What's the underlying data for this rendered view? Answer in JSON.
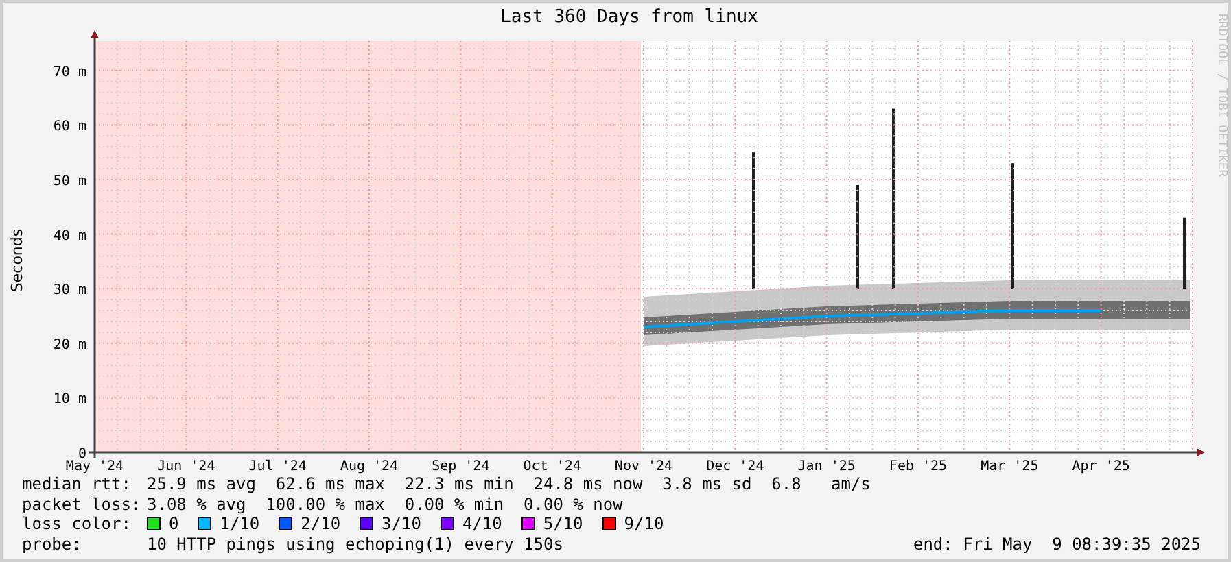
{
  "graph": {
    "credit": "RRDTOOL / TOBI OETIKER",
    "chart_data": {
      "type": "line",
      "title": "Last 360 Days from linux",
      "ylabel": "Seconds",
      "grid": true,
      "categories": [
        "May '24",
        "Jun '24",
        "Jul '24",
        "Aug '24",
        "Sep '24",
        "Oct '24",
        "Nov '24",
        "Dec '24",
        "Jan '25",
        "Feb '25",
        "Mar '25",
        "Apr '25"
      ],
      "ylim": [
        0,
        75
      ],
      "yticks": [
        {
          "value": 0,
          "label": "0"
        },
        {
          "value": 10,
          "label": "10 m"
        },
        {
          "value": 20,
          "label": "20 m"
        },
        {
          "value": 30,
          "label": "30 m"
        },
        {
          "value": 40,
          "label": "40 m"
        },
        {
          "value": 50,
          "label": "50 m"
        },
        {
          "value": 60,
          "label": "60 m"
        },
        {
          "value": 70,
          "label": "70 m"
        }
      ],
      "series": [
        {
          "name": "median rtt:",
          "color": "#00a0f0",
          "values": [
            null,
            null,
            null,
            null,
            null,
            null,
            23,
            24,
            25,
            25.5,
            26,
            26
          ]
        }
      ]
    }
  },
  "legend": {
    "lines": [
      {
        "text": "25.9 ms avg  62.6 ms max  22.3 ms min  24.8 ms now  3.8 ms sd  6.8   am/s"
      },
      {
        "label": "packet loss:",
        "text": "3.08 % avg  100.00 % max  0.00 % min  0.00 % now"
      }
    ],
    "loss_color": {
      "label": "loss color:",
      "items": [
        {
          "text": "0",
          "color": "#20e020"
        },
        {
          "text": "1/10",
          "color": "#00b8ff"
        },
        {
          "text": "2/10",
          "color": "#0059ff"
        },
        {
          "text": "3/10",
          "color": "#5e00ff"
        },
        {
          "text": "4/10",
          "color": "#7e00ff"
        },
        {
          "text": "5/10",
          "color": "#dd00ff"
        },
        {
          "text": "9/10",
          "color": "#ff0000"
        }
      ]
    },
    "probe": {
      "label": "probe:",
      "text": "10 HTTP pings using echoping(1) every 150s"
    },
    "end": "end: Fri May  9 08:39:35 2025"
  }
}
